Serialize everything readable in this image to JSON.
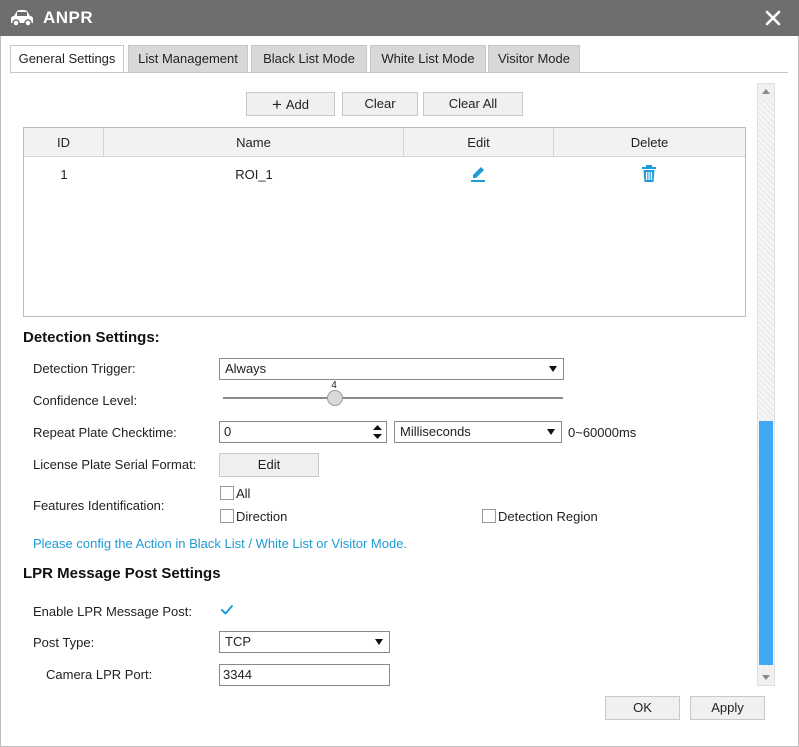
{
  "window": {
    "title": "ANPR"
  },
  "tabs": [
    {
      "label": "General Settings",
      "active": true
    },
    {
      "label": "List Management",
      "active": false
    },
    {
      "label": "Black List Mode",
      "active": false
    },
    {
      "label": "White List Mode",
      "active": false
    },
    {
      "label": "Visitor Mode",
      "active": false
    }
  ],
  "toolbar": {
    "add_label": "Add",
    "clear_label": "Clear",
    "clear_all_label": "Clear All"
  },
  "table": {
    "headers": [
      "ID",
      "Name",
      "Edit",
      "Delete"
    ],
    "rows": [
      {
        "id": "1",
        "name": "ROI_1"
      }
    ]
  },
  "detection": {
    "title": "Detection Settings:",
    "trigger_label": "Detection Trigger:",
    "trigger_value": "Always",
    "confidence_label": "Confidence Level:",
    "confidence_value": "4",
    "confidence_fraction": 0.33,
    "repeat_label": "Repeat Plate Checktime:",
    "repeat_value": "0",
    "repeat_unit": "Milliseconds",
    "repeat_range": "0~60000ms",
    "serial_label": "License Plate Serial Format:",
    "serial_button": "Edit",
    "features_label": "Features Identification:",
    "features": {
      "all": "All",
      "direction": "Direction",
      "region": "Detection Region"
    },
    "hint": "Please config the Action in Black List / White List or Visitor Mode."
  },
  "lpr": {
    "title": "LPR Message Post Settings",
    "enable_label": "Enable LPR Message Post:",
    "enable_checked": true,
    "post_type_label": "Post Type:",
    "post_type_value": "TCP",
    "port_label": "Camera LPR Port:",
    "port_value": "3344"
  },
  "footer": {
    "ok_label": "OK",
    "apply_label": "Apply"
  },
  "colors": {
    "titlebar": "#6e6e6e",
    "accent": "#1d9bd6",
    "scroll_thumb": "#3fa9f5"
  }
}
